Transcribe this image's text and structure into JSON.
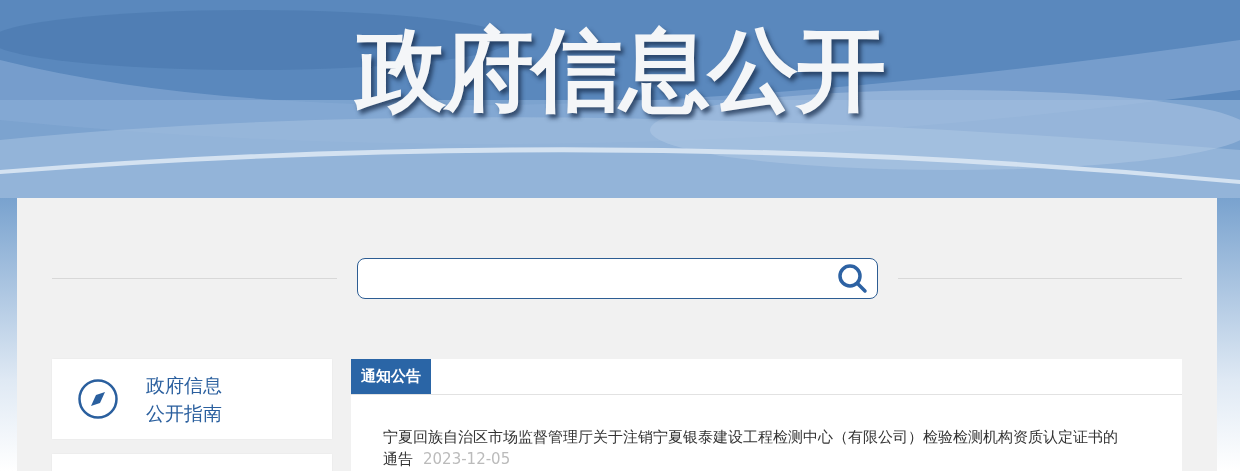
{
  "banner": {
    "title": "政府信息公开"
  },
  "sidebar": {
    "items": [
      {
        "kind": "compass",
        "label": [
          "政府信息",
          "公开指南"
        ]
      },
      {
        "kind": "blank"
      }
    ]
  },
  "notice": {
    "tabs": [
      {
        "label": "通知公告",
        "selected": true
      }
    ],
    "items": [
      {
        "title": "宁夏回族自治区市场监督管理厅关于注销宁夏银泰建设工程检测中心（有限公司）检验检测机构资质认定证书的通告",
        "date": "2023-12-05"
      }
    ]
  }
}
